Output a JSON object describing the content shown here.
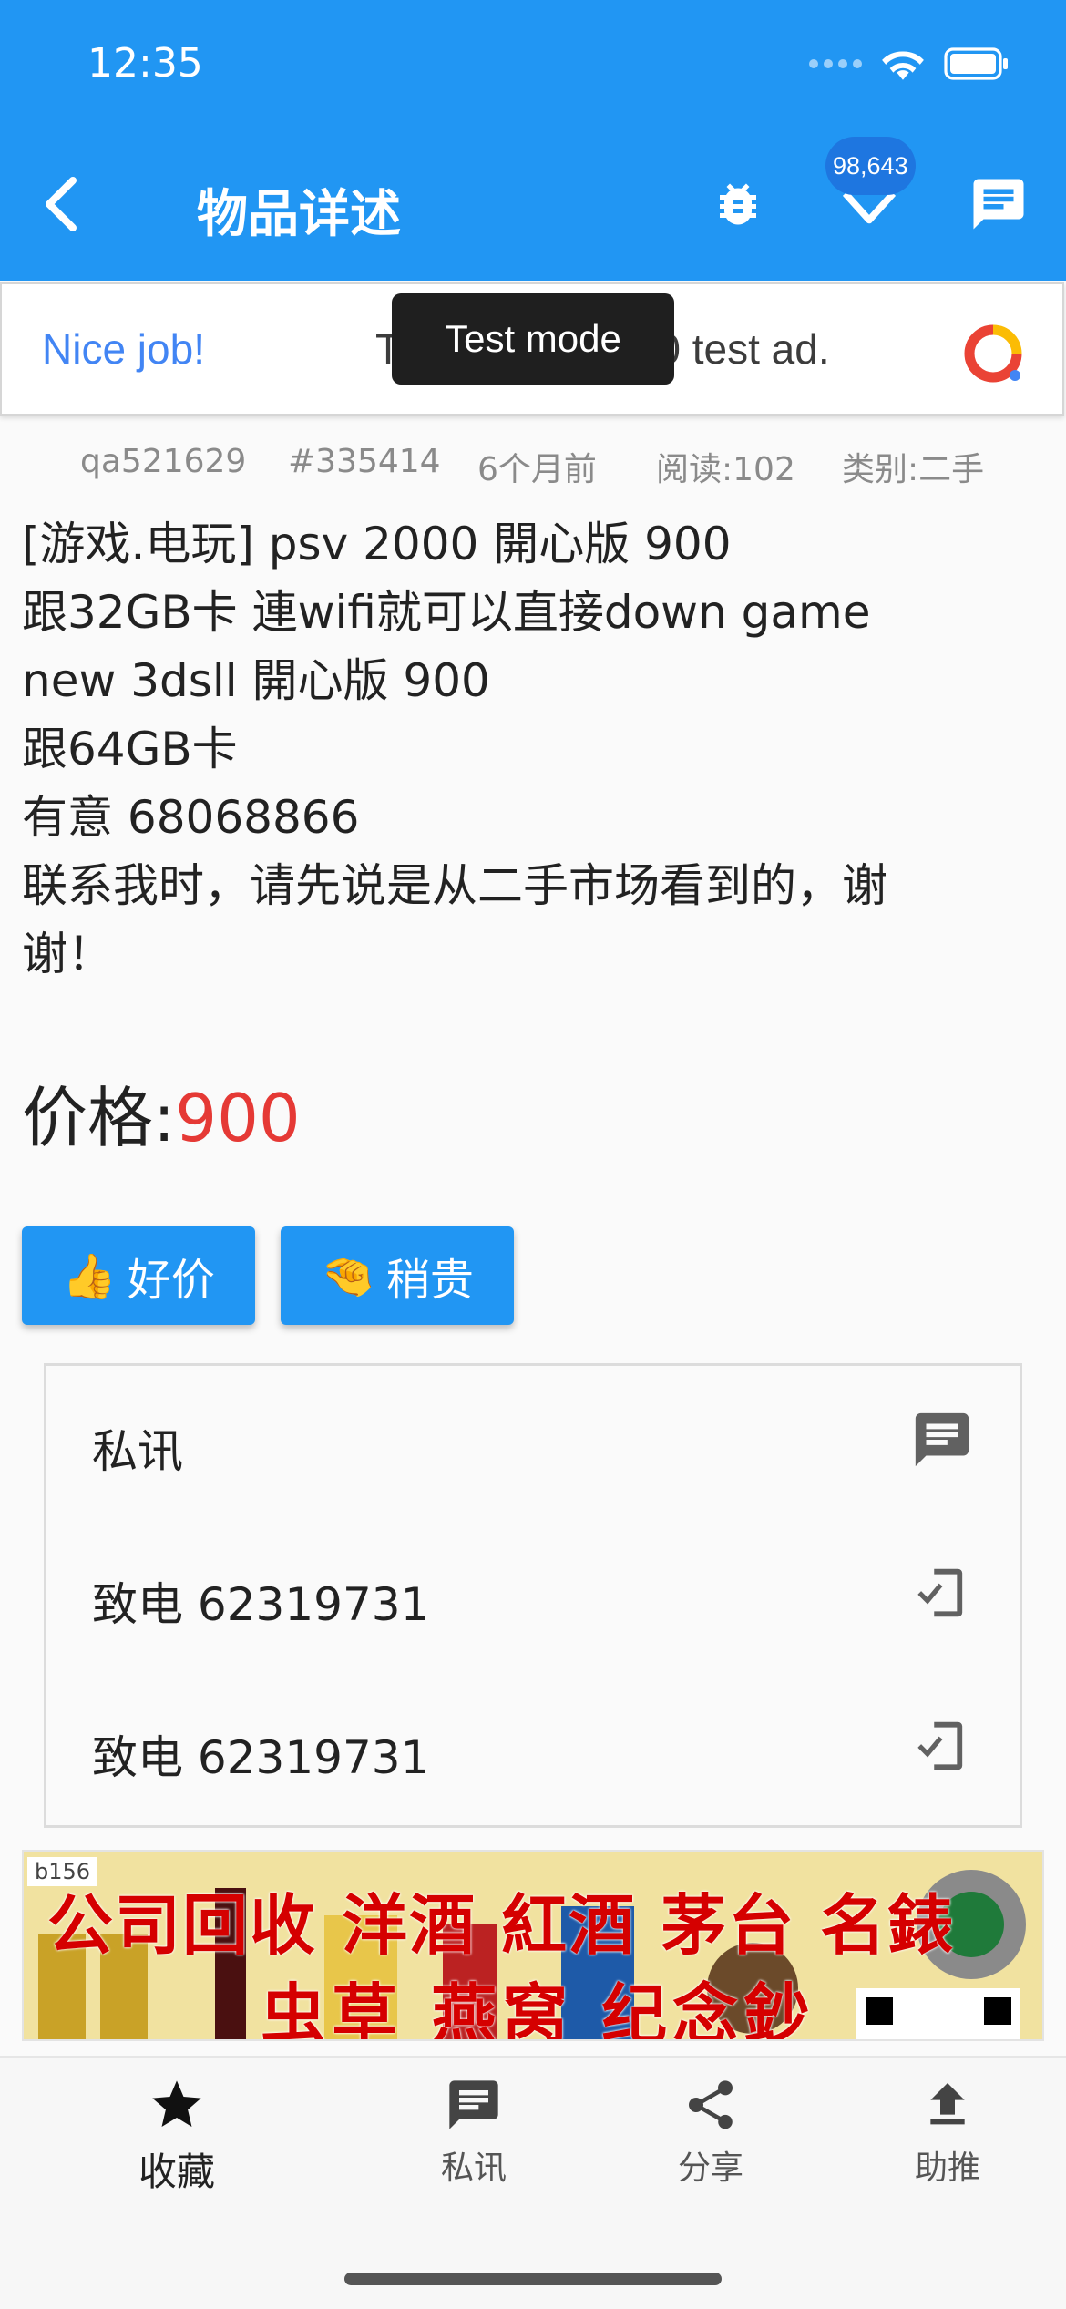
{
  "status_bar": {
    "time": "12:35"
  },
  "appbar": {
    "title": "物品详述",
    "badge_count": "98,643",
    "icons": [
      "back-arrow-icon",
      "bug-icon",
      "download-icon",
      "message-icon"
    ],
    "background_color": "#2196f3"
  },
  "ad_banner": {
    "headline": "Nice job!",
    "text": "This is a 320x50 test ad.",
    "toast": "Test mode"
  },
  "meta": {
    "author": "qa521629",
    "item_id": "#335414",
    "posted": "6个月前",
    "reads": "阅读:102",
    "category": "类别:二手"
  },
  "description_lines": [
    "[游戏.电玩] psv 2000 開心版 900",
    "跟32GB卡 連wifi就可以直接down game",
    "new 3dsll 開心版 900",
    "跟64GB卡",
    "有意 68068866",
    "联系我时，请先说是从二手市场看到的，谢",
    "谢！"
  ],
  "price": {
    "label": "价格:",
    "value": "900",
    "value_color": "#e53935"
  },
  "vote_buttons": [
    {
      "emoji": "👍",
      "label": "好价"
    },
    {
      "emoji": "🤏",
      "label": "稍贵"
    }
  ],
  "contact": [
    {
      "label": "私讯",
      "icon": "message-icon"
    },
    {
      "label": "致电 62319731",
      "icon": "phone-check-icon"
    },
    {
      "label": "致电 62319731",
      "icon": "phone-check-icon"
    }
  ],
  "ad_image": {
    "tag": "b156",
    "line1": "公司回收 洋酒 紅酒 茅台 名錶",
    "line2": "虫草 燕窝 纪念鈔"
  },
  "bottom_nav": [
    {
      "label": "收藏",
      "icon": "star-icon",
      "active": true
    },
    {
      "label": "私讯",
      "icon": "message-icon",
      "active": false
    },
    {
      "label": "分享",
      "icon": "share-icon",
      "active": false
    },
    {
      "label": "助推",
      "icon": "upload-icon",
      "active": false
    }
  ]
}
